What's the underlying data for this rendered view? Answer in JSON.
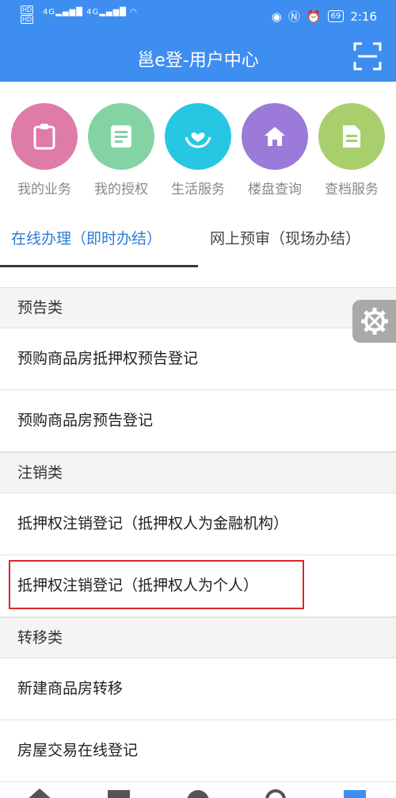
{
  "status_bar": {
    "left_text_1": "HD",
    "left_text_2": "HD",
    "signal_1": "4G",
    "signal_2": "4G",
    "battery": "69",
    "time": "2:16"
  },
  "header": {
    "title": "邕e登-用户中心",
    "scan_icon": "scan-icon"
  },
  "quick_icons": [
    {
      "label": "我的业务",
      "icon": "clipboard-icon",
      "color": "#de7ba6"
    },
    {
      "label": "我的授权",
      "icon": "document-icon",
      "color": "#83d3a5"
    },
    {
      "label": "生活服务",
      "icon": "hands-heart-icon",
      "color": "#27c7e3"
    },
    {
      "label": "楼盘查询",
      "icon": "house-icon",
      "color": "#9b7ad9"
    },
    {
      "label": "查档服务",
      "icon": "file-icon",
      "color": "#a9cf6d"
    }
  ],
  "tabs": [
    {
      "label": "在线办理（即时办结）",
      "active": true
    },
    {
      "label": "网上预审（现场办结）",
      "active": false
    }
  ],
  "sections": [
    {
      "title": "预告类",
      "items": [
        "预购商品房抵押权预告登记",
        "预购商品房预告登记"
      ]
    },
    {
      "title": "注销类",
      "items": [
        "抵押权注销登记（抵押权人为金融机构）",
        "抵押权注销登记（抵押权人为个人）"
      ]
    },
    {
      "title": "转移类",
      "items": [
        "新建商品房转移",
        "房屋交易在线登记"
      ]
    }
  ],
  "colors": {
    "header_blue": "#3d8ef0",
    "active_tab": "#2c7bd6",
    "highlight_border": "#d8262b"
  }
}
